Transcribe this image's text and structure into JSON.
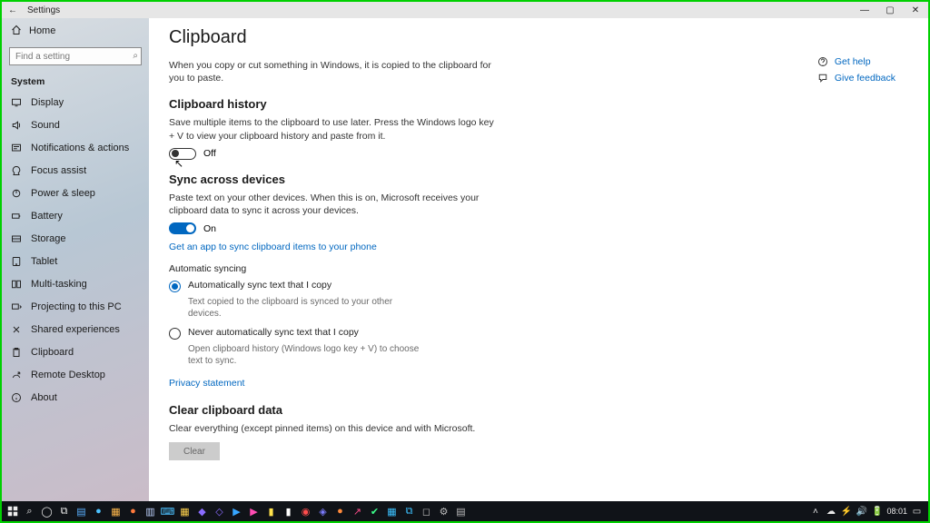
{
  "window": {
    "title": "Settings"
  },
  "sidebar": {
    "home": "Home",
    "search_placeholder": "Find a setting",
    "category": "System",
    "items": [
      {
        "label": "Display",
        "icon": "display"
      },
      {
        "label": "Sound",
        "icon": "sound"
      },
      {
        "label": "Notifications & actions",
        "icon": "notifications"
      },
      {
        "label": "Focus assist",
        "icon": "focus"
      },
      {
        "label": "Power & sleep",
        "icon": "power"
      },
      {
        "label": "Battery",
        "icon": "battery"
      },
      {
        "label": "Storage",
        "icon": "storage"
      },
      {
        "label": "Tablet",
        "icon": "tablet"
      },
      {
        "label": "Multi-tasking",
        "icon": "multitask"
      },
      {
        "label": "Projecting to this PC",
        "icon": "project"
      },
      {
        "label": "Shared experiences",
        "icon": "shared"
      },
      {
        "label": "Clipboard",
        "icon": "clipboard"
      },
      {
        "label": "Remote Desktop",
        "icon": "remote"
      },
      {
        "label": "About",
        "icon": "about"
      }
    ]
  },
  "page": {
    "title": "Clipboard",
    "intro": "When you copy or cut something in Windows, it is copied to the clipboard for you to paste.",
    "history": {
      "heading": "Clipboard history",
      "desc": "Save multiple items to the clipboard to use later. Press the Windows logo key + V to view your clipboard history and paste from it.",
      "toggle_state": "Off",
      "toggle_on": false
    },
    "sync": {
      "heading": "Sync across devices",
      "desc": "Paste text on your other devices. When this is on, Microsoft receives your clipboard data to sync it across your devices.",
      "toggle_state": "On",
      "toggle_on": true,
      "app_link": "Get an app to sync clipboard items to your phone",
      "auto_label": "Automatic syncing",
      "options": [
        {
          "label": "Automatically sync text that I copy",
          "hint": "Text copied to the clipboard is synced to your other devices.",
          "selected": true
        },
        {
          "label": "Never automatically sync text that I copy",
          "hint": "Open clipboard history (Windows logo key + V) to choose text to sync.",
          "selected": false
        }
      ],
      "privacy_link": "Privacy statement"
    },
    "clear": {
      "heading": "Clear clipboard data",
      "desc": "Clear everything (except pinned items) on this device and with Microsoft.",
      "button": "Clear"
    }
  },
  "aside": {
    "help": "Get help",
    "feedback": "Give feedback"
  },
  "taskbar": {
    "clock": "08:01"
  }
}
